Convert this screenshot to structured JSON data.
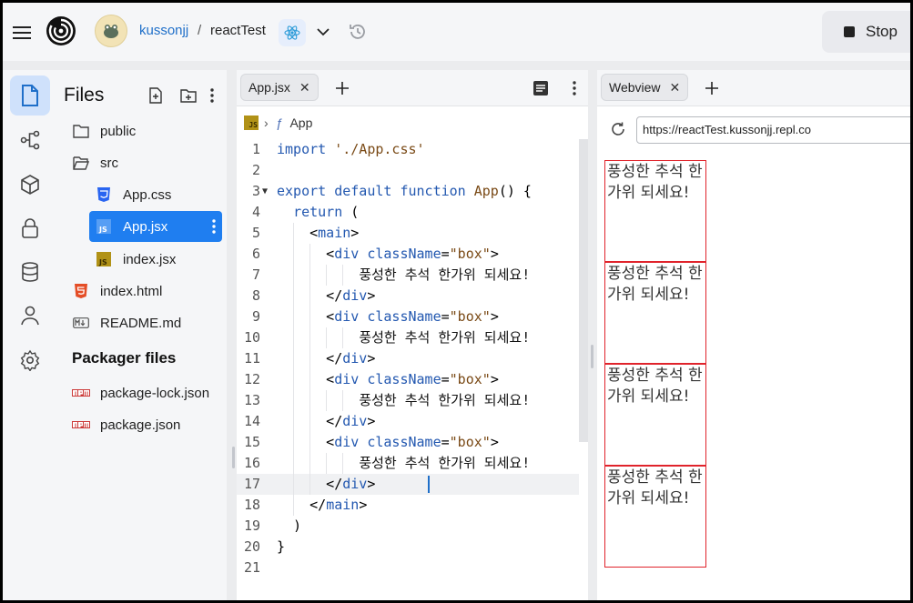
{
  "topbar": {
    "user": "kussonjj",
    "separator": "/",
    "repo": "reactTest",
    "stop_label": "Stop",
    "icons": [
      "menu-icon",
      "replit-logo-icon",
      "avatar",
      "react-icon",
      "chevron-down-icon",
      "history-icon",
      "stop-icon"
    ]
  },
  "rail": {
    "items": [
      "files-icon",
      "git-branch-icon",
      "package-icon",
      "lock-icon",
      "database-icon",
      "user-icon",
      "gear-icon"
    ],
    "active": "files-icon"
  },
  "files": {
    "title": "Files",
    "tree": [
      {
        "label": "public",
        "icon": "folder-icon",
        "indent": 0
      },
      {
        "label": "src",
        "icon": "folder-open-icon",
        "indent": 0
      },
      {
        "label": "App.css",
        "icon": "css-file-icon",
        "indent": 1
      },
      {
        "label": "App.jsx",
        "icon": "js-file-icon",
        "indent": 1,
        "selected": true
      },
      {
        "label": "index.jsx",
        "icon": "js-file-icon",
        "indent": 1
      },
      {
        "label": "index.html",
        "icon": "html-file-icon",
        "indent": 0
      },
      {
        "label": "README.md",
        "icon": "markdown-file-icon",
        "indent": 0
      }
    ],
    "packager_title": "Packager files",
    "packager": [
      {
        "label": "package-lock.json",
        "icon": "npm-icon"
      },
      {
        "label": "package.json",
        "icon": "npm-icon"
      }
    ]
  },
  "editor": {
    "tab": "App.jsx",
    "breadcrumb_badge": "JS",
    "breadcrumb_fn_symbol": "ƒ",
    "breadcrumb": "App",
    "active_line": 17,
    "lines": [
      {
        "n": "1",
        "html": "<span class=\"kw\">import</span> <span class=\"str\">'./App.css'</span>"
      },
      {
        "n": "2",
        "html": ""
      },
      {
        "n": "3",
        "fold": true,
        "html": "<span class=\"kw\">export default function</span> <span class=\"fnm\">App</span>() {"
      },
      {
        "n": "4",
        "html": "  <span class=\"kw\">return</span> ("
      },
      {
        "n": "5",
        "html": "    &lt;<span class=\"tag\">main</span>&gt;"
      },
      {
        "n": "6",
        "html": "      &lt;<span class=\"tag\">div</span> <span class=\"attr\">className</span>=<span class=\"str\">\"box\"</span>&gt;"
      },
      {
        "n": "7",
        "html": "          <span class=\"txt\">풍성한 추석 한가위 되세요!</span>"
      },
      {
        "n": "8",
        "html": "      &lt;/<span class=\"tag\">div</span>&gt;"
      },
      {
        "n": "9",
        "html": "      &lt;<span class=\"tag\">div</span> <span class=\"attr\">className</span>=<span class=\"str\">\"box\"</span>&gt;"
      },
      {
        "n": "10",
        "html": "          <span class=\"txt\">풍성한 추석 한가위 되세요!</span>"
      },
      {
        "n": "11",
        "html": "      &lt;/<span class=\"tag\">div</span>&gt;"
      },
      {
        "n": "12",
        "html": "      &lt;<span class=\"tag\">div</span> <span class=\"attr\">className</span>=<span class=\"str\">\"box\"</span>&gt;"
      },
      {
        "n": "13",
        "html": "          <span class=\"txt\">풍성한 추석 한가위 되세요!</span>"
      },
      {
        "n": "14",
        "html": "      &lt;/<span class=\"tag\">div</span>&gt;"
      },
      {
        "n": "15",
        "html": "      &lt;<span class=\"tag\">div</span> <span class=\"attr\">className</span>=<span class=\"str\">\"box\"</span>&gt;"
      },
      {
        "n": "16",
        "html": "          <span class=\"txt\">풍성한 추석 한가위 되세요!</span>"
      },
      {
        "n": "17",
        "html": "      &lt;/<span class=\"tag\">div</span>&gt;"
      },
      {
        "n": "18",
        "html": "    &lt;/<span class=\"tag\">main</span>&gt;"
      },
      {
        "n": "19",
        "html": "  )"
      },
      {
        "n": "20",
        "html": "}"
      },
      {
        "n": "21",
        "html": ""
      }
    ]
  },
  "webview": {
    "tab": "Webview",
    "url": "https://reactTest.kussonjj.repl.co",
    "boxes": [
      "풍성한 추석 한가위 되세요!",
      "풍성한 추석 한가위 되세요!",
      "풍성한 추석 한가위 되세요!",
      "풍성한 추석 한가위 되세요!"
    ]
  },
  "colors": {
    "accent": "#1f7ef0",
    "link": "#1f6fc9",
    "box_border": "#e0232b"
  }
}
